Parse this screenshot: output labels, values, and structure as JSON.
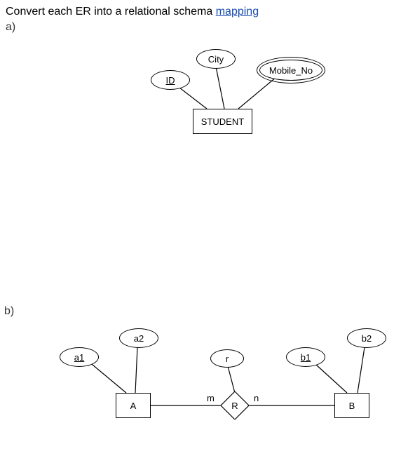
{
  "heading_prefix": "Convert each ER into a relational schema ",
  "heading_link": "mapping",
  "part_a": "a)",
  "part_b": "b)",
  "diagram_a": {
    "entity": "STUDENT",
    "attr_id": "ID",
    "attr_city": "City",
    "attr_mobile": "Mobile_No"
  },
  "diagram_b": {
    "entity_A": "A",
    "entity_B": "B",
    "rel_R": "R",
    "attr_a1": "a1",
    "attr_a2": "a2",
    "attr_b1": "b1",
    "attr_b2": "b2",
    "attr_r": "r",
    "card_left": "m",
    "card_right": "n"
  }
}
